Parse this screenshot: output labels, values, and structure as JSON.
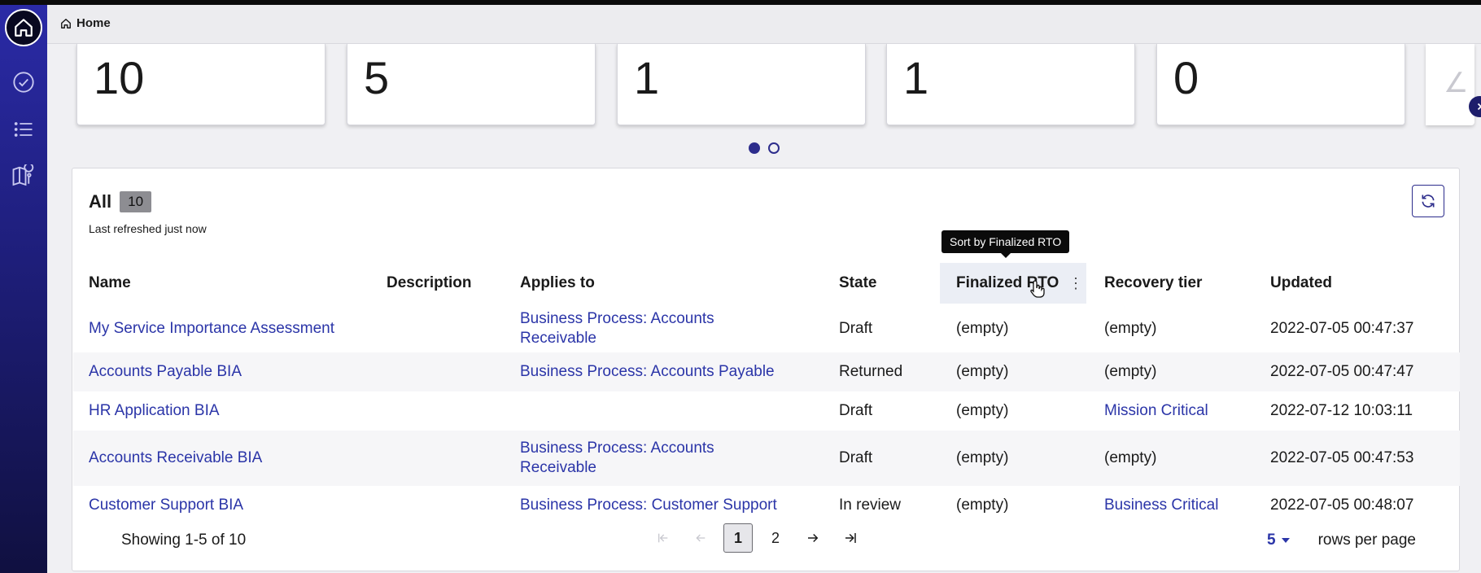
{
  "breadcrumb": {
    "label": "Home"
  },
  "cards": [
    {
      "value": "10"
    },
    {
      "value": "5"
    },
    {
      "value": "1"
    },
    {
      "value": "1"
    },
    {
      "value": "0"
    }
  ],
  "carousel": {
    "pages": 2,
    "current": 1
  },
  "panel": {
    "title": "All",
    "count": "10",
    "refreshed": "Last refreshed just now"
  },
  "tooltip": "Sort by Finalized RTO",
  "columns": {
    "name": "Name",
    "description": "Description",
    "applies_to": "Applies to",
    "state": "State",
    "finalized_rto": "Finalized RTO",
    "recovery_tier": "Recovery tier",
    "updated": "Updated"
  },
  "rows": [
    {
      "name": "My Service Importance Assessment",
      "description": "",
      "applies_to": "Business Process: Accounts Receivable",
      "state": "Draft",
      "finalized_rto": "(empty)",
      "recovery_tier": "(empty)",
      "updated": "2022-07-05 00:47:37"
    },
    {
      "name": "Accounts Payable BIA",
      "description": "",
      "applies_to": "Business Process: Accounts Payable",
      "state": "Returned",
      "finalized_rto": "(empty)",
      "recovery_tier": "(empty)",
      "updated": "2022-07-05 00:47:47"
    },
    {
      "name": "HR Application BIA",
      "description": "",
      "applies_to": "",
      "state": "Draft",
      "finalized_rto": "(empty)",
      "recovery_tier": "Mission Critical",
      "updated": "2022-07-12 10:03:11"
    },
    {
      "name": "Accounts Receivable BIA",
      "description": "",
      "applies_to": "Business Process: Accounts Receivable",
      "state": "Draft",
      "finalized_rto": "(empty)",
      "recovery_tier": "(empty)",
      "updated": "2022-07-05 00:47:53"
    },
    {
      "name": "Customer Support BIA",
      "description": "",
      "applies_to": "Business Process: Customer Support",
      "state": "In review",
      "finalized_rto": "(empty)",
      "recovery_tier": "Business Critical",
      "updated": "2022-07-05 00:48:07"
    }
  ],
  "pagination": {
    "showing": "Showing 1-5 of 10",
    "pages": [
      "1",
      "2"
    ],
    "current": "1",
    "rows_per_page_value": "5",
    "rows_per_page_label": "rows per page"
  },
  "icons": {
    "sidebar": [
      "home-icon",
      "check-circle-icon",
      "list-icon",
      "map-pin-icon"
    ],
    "accent": "#2b35a8",
    "sidebar_top": "#2a2aa6",
    "sidebar_bottom": "#101040"
  }
}
